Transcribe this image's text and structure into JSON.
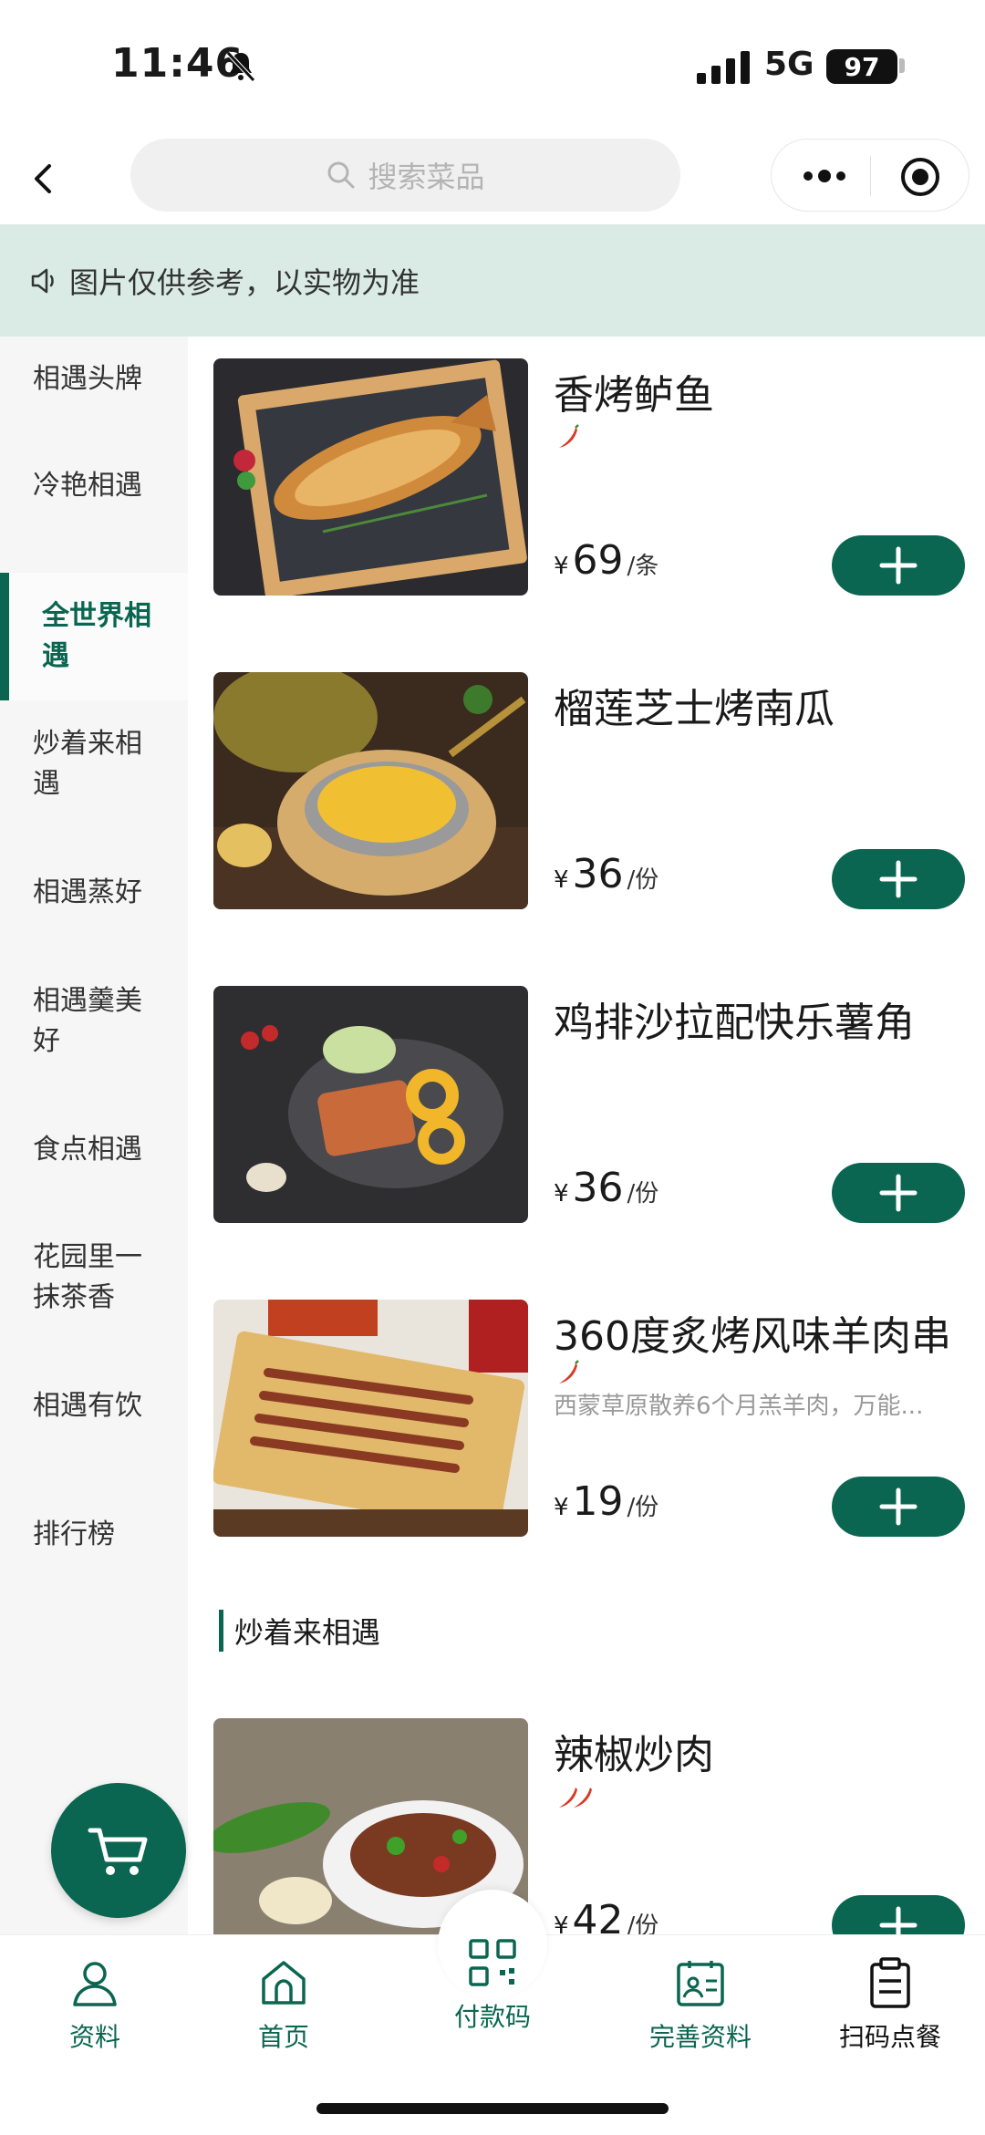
{
  "status_bar": {
    "time": "11:46",
    "network": "5G",
    "battery": "97"
  },
  "nav": {
    "search_placeholder": "搜索菜品"
  },
  "notice": {
    "text": "图片仅供参考，以实物为准"
  },
  "sidebar": {
    "categories": [
      {
        "label": "相遇头牌",
        "active": false
      },
      {
        "label": "冷艳相遇",
        "active": false
      },
      {
        "label": "全世界相遇",
        "active": true
      },
      {
        "label": "炒着来相遇",
        "active": false
      },
      {
        "label": "相遇蒸好",
        "active": false
      },
      {
        "label": "相遇羹美好",
        "active": false
      },
      {
        "label": "食点相遇",
        "active": false
      },
      {
        "label": "花园里一抹茶香",
        "active": false
      },
      {
        "label": "相遇有饮",
        "active": false
      },
      {
        "label": "排行榜",
        "active": false
      }
    ]
  },
  "dishes": [
    {
      "name": "香烤鲈鱼",
      "spicy_level": 1,
      "description": "",
      "currency": "¥",
      "price": "69",
      "unit": "/条"
    },
    {
      "name": "榴莲芝士烤南瓜",
      "spicy_level": 0,
      "description": "",
      "currency": "¥",
      "price": "36",
      "unit": "/份"
    },
    {
      "name": "鸡排沙拉配快乐薯角",
      "spicy_level": 0,
      "description": "",
      "currency": "¥",
      "price": "36",
      "unit": "/份"
    },
    {
      "name": "360度炙烤风味羊肉串",
      "spicy_level": 1,
      "description": "西蒙草原散养6个月羔羊肉，万能...",
      "currency": "¥",
      "price": "19",
      "unit": "/份"
    }
  ],
  "section": {
    "title": "炒着来相遇",
    "dishes": [
      {
        "name": "辣椒炒肉",
        "spicy_level": 2,
        "currency": "¥",
        "price": "42",
        "unit": "/份"
      }
    ]
  },
  "tabbar": {
    "items": [
      {
        "label": "资料",
        "icon": "user-icon"
      },
      {
        "label": "首页",
        "icon": "home-icon"
      },
      {
        "label": "付款码",
        "icon": "qr-code-icon"
      },
      {
        "label": "完善资料",
        "icon": "profile-card-icon"
      },
      {
        "label": "扫码点餐",
        "icon": "clipboard-icon"
      }
    ]
  },
  "colors": {
    "brand": "#0a6650",
    "notice_bg": "#d9ebe4",
    "sidebar_bg": "#f6f6f6"
  }
}
